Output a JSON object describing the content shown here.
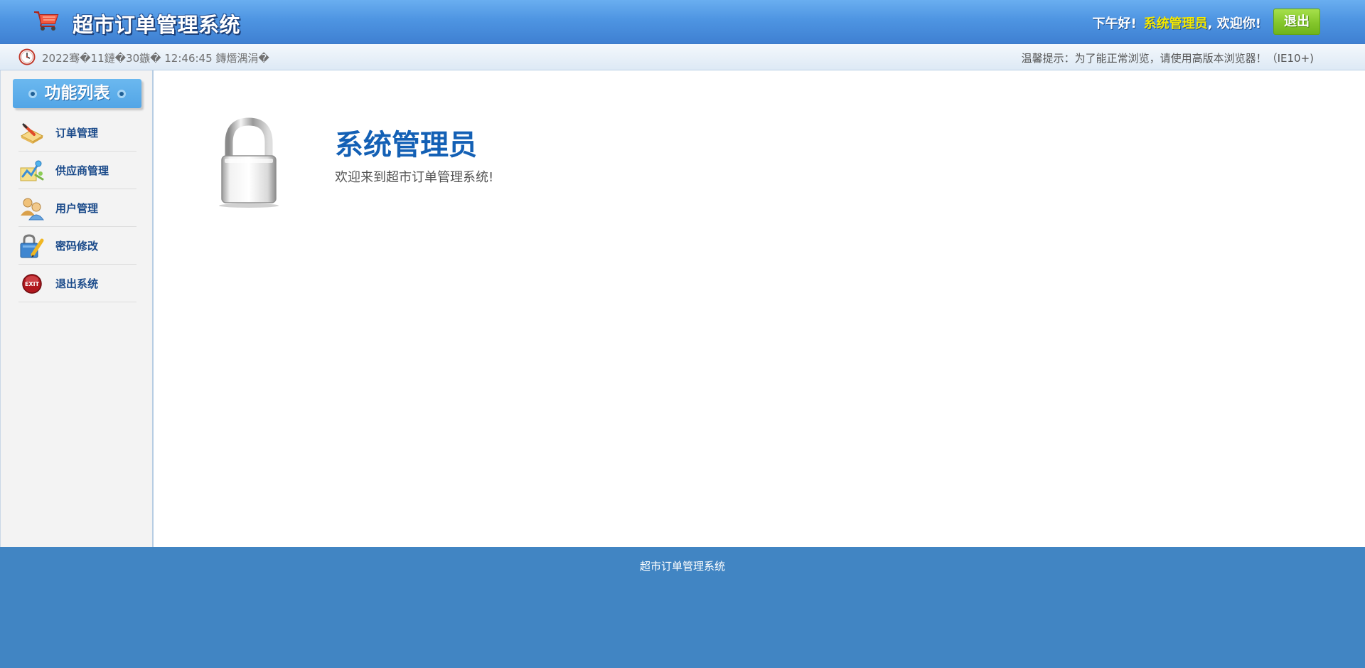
{
  "header": {
    "app_title": "超市订单管理系统",
    "greeting": "下午好!",
    "user_name": "系统管理员",
    "welcome_suffix": ", 欢迎你!",
    "logout_label": "退出",
    "logo_icon": "shopping-cart-icon"
  },
  "subbar": {
    "clock_icon": "clock-icon",
    "datetime": "2022骞�11鏈�30鏃� 12:46:45 鏄熸湡涓�",
    "tip": "温馨提示：为了能正常浏览，请使用高版本浏览器！（IE10+)"
  },
  "sidebar": {
    "title": "功能列表",
    "items": [
      {
        "label": "订单管理",
        "icon": "order-icon"
      },
      {
        "label": "供应商管理",
        "icon": "supplier-icon"
      },
      {
        "label": "用户管理",
        "icon": "users-icon"
      },
      {
        "label": "密码修改",
        "icon": "password-icon"
      },
      {
        "label": "退出系统",
        "icon": "exit-icon"
      }
    ]
  },
  "main": {
    "welcome_name": "系统管理员",
    "welcome_text": "欢迎来到超市订单管理系统!",
    "lock_icon": "lock-icon"
  },
  "footer": {
    "text": "超市订单管理系统"
  },
  "colors": {
    "header_blue": "#4e95e2",
    "accent_yellow": "#f5e900",
    "logout_green": "#84c62b",
    "title_blue": "#1360b5",
    "footer_blue": "#4185c3"
  }
}
